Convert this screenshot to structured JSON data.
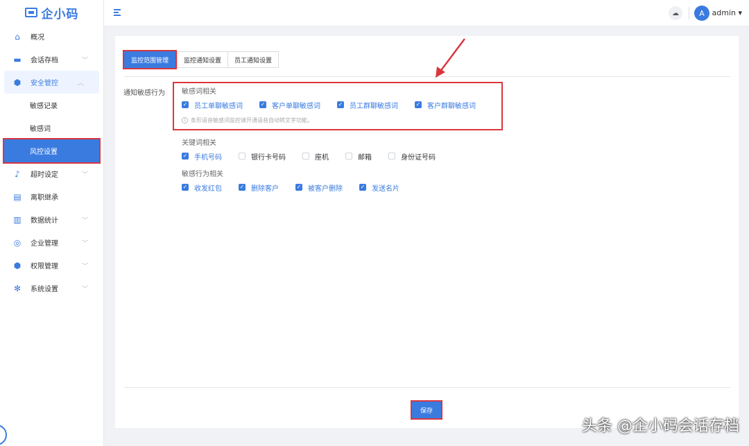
{
  "app": {
    "logo_text": "企小码"
  },
  "header": {
    "user_initial": "A",
    "user_name": "admin",
    "user_caret": "▾"
  },
  "sidebar": {
    "items": [
      {
        "label": "概况",
        "icon": "home-icon"
      },
      {
        "label": "会话存档",
        "icon": "folder-icon",
        "arrow": "﹀"
      },
      {
        "label": "安全管控",
        "icon": "shield-icon",
        "arrow": "︿"
      },
      {
        "label": "超时设定",
        "icon": "bell-icon",
        "arrow": "﹀"
      },
      {
        "label": "离职继承",
        "icon": "transfer-icon"
      },
      {
        "label": "数据统计",
        "icon": "chart-icon",
        "arrow": "﹀"
      },
      {
        "label": "企业管理",
        "icon": "org-icon",
        "arrow": "﹀"
      },
      {
        "label": "权限管理",
        "icon": "lock-icon",
        "arrow": "﹀"
      },
      {
        "label": "系统设置",
        "icon": "gear-icon",
        "arrow": "﹀"
      }
    ],
    "sub_items": [
      {
        "label": "敏感记录"
      },
      {
        "label": "敏感词"
      },
      {
        "label": "风控设置"
      }
    ]
  },
  "tabs": [
    {
      "label": "监控范围管理"
    },
    {
      "label": "监控通知设置"
    },
    {
      "label": "员工通知设置"
    }
  ],
  "form": {
    "field_label": "通知敏感行为",
    "sensitive_words": {
      "title": "敏感词相关",
      "options": [
        {
          "label": "员工单聊敏感词",
          "checked": true
        },
        {
          "label": "客户单聊敏感词",
          "checked": true
        },
        {
          "label": "员工群聊敏感词",
          "checked": true
        },
        {
          "label": "客户群聊敏感词",
          "checked": true
        }
      ],
      "hint": "条形语音敏感词监控请开通语音自动转文字功能。"
    },
    "keywords": {
      "title": "关键词相关",
      "options": [
        {
          "label": "手机号码",
          "checked": true
        },
        {
          "label": "银行卡号码",
          "checked": false
        },
        {
          "label": "座机",
          "checked": false
        },
        {
          "label": "邮箱",
          "checked": false
        },
        {
          "label": "身份证号码",
          "checked": false
        }
      ]
    },
    "behaviors": {
      "title": "敏感行为相关",
      "options": [
        {
          "label": "收发红包",
          "checked": true
        },
        {
          "label": "删除客户",
          "checked": true
        },
        {
          "label": "被客户删除",
          "checked": true
        },
        {
          "label": "发送名片",
          "checked": true
        }
      ]
    },
    "save_label": "保存"
  },
  "watermark": "头条 @企小码会话存档",
  "colors": {
    "accent": "#3a7be0",
    "annotation": "#d9363e"
  }
}
